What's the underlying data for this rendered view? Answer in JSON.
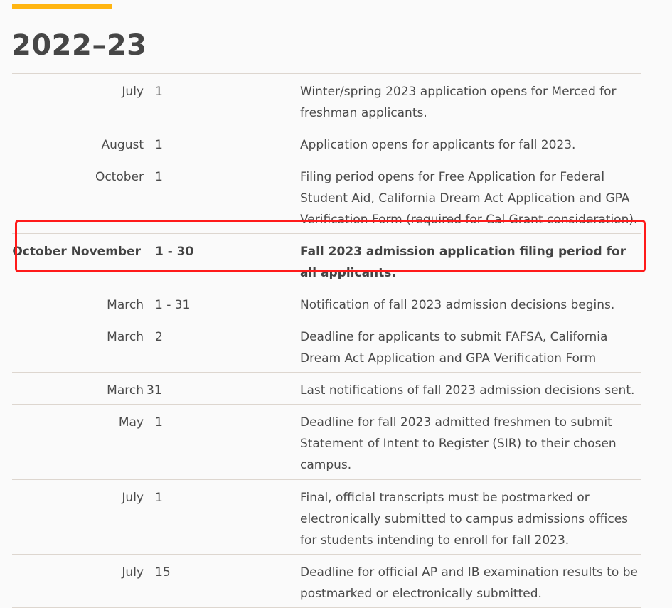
{
  "section": {
    "title": "2022–23",
    "accent_color": "#ffb511",
    "highlight_color": "#ff1a1a"
  },
  "rows": [
    {
      "month": "July",
      "day": "1",
      "description": "Winter/spring 2023 application opens for Merced for freshman applicants."
    },
    {
      "month": "August",
      "day": "1",
      "description": "Application opens for applicants for fall 2023."
    },
    {
      "month": "October",
      "day": "1",
      "description": "Filing period opens for Free Application for Federal Student Aid, California Dream Act Application and GPA Verification Form (required for Cal Grant consideration)."
    },
    {
      "month": "October November",
      "day": "1 - 30",
      "description": "Fall 2023 admission application filing period for all applicants.",
      "highlighted": true
    },
    {
      "month": "March",
      "day": "1 - 31",
      "description": "Notification of fall 2023 admission decisions begins."
    },
    {
      "month": "March",
      "day": "2",
      "description": "Deadline for applicants to submit FAFSA, California Dream Act Application and GPA Verification Form"
    },
    {
      "month": "March",
      "day": "31",
      "description": "Last notifications of fall 2023 admission decisions sent."
    },
    {
      "month": "May",
      "day": "1",
      "description": "Deadline for fall 2023 admitted freshmen to submit Statement of Intent to Register (SIR) to their chosen campus."
    },
    {
      "month": "July",
      "day": "1",
      "description": "Final, official transcripts must be postmarked or electronically submitted to campus admissions offices for students intending to enroll for fall 2023."
    },
    {
      "month": "July",
      "day": "15",
      "description": "Deadline for official AP and IB examination results to be postmarked or electronically submitted."
    }
  ]
}
